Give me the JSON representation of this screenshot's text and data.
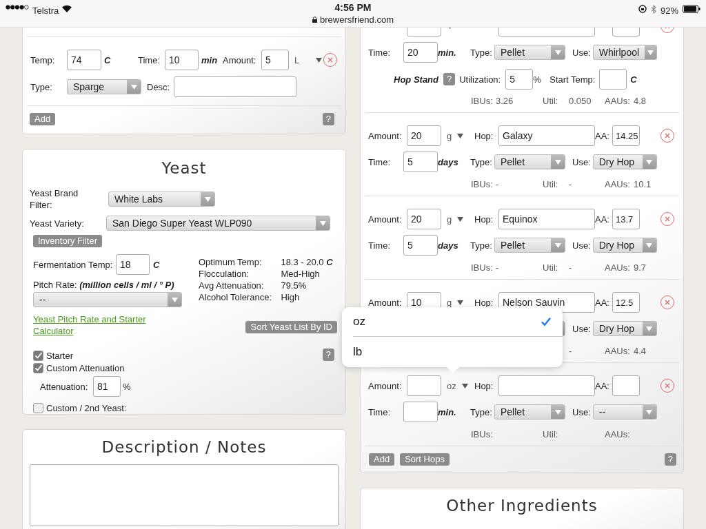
{
  "status_bar": {
    "carrier": "Telstra",
    "time": "4:56 PM",
    "url": "brewersfriend.com",
    "battery": "92%"
  },
  "mash_step": {
    "temp_label": "Temp:",
    "temp": "74",
    "temp_unit": "C",
    "time_label": "Time:",
    "time": "10",
    "time_unit": "min",
    "amount_label": "Amount:",
    "amount": "5",
    "amount_unit": "L",
    "type_label": "Type:",
    "type": "Sparge",
    "desc_label": "Desc:",
    "add": "Add",
    "help": "?"
  },
  "yeast": {
    "title": "Yeast",
    "brand_label": "Yeast Brand Filter:",
    "brand": "White Labs",
    "variety_label": "Yeast Variety:",
    "variety": "San Diego Super Yeast WLP090",
    "inventory": "Inventory Filter",
    "ferm_label": "Fermentation Temp:",
    "ferm": "18",
    "ferm_unit": "C",
    "pitch_label": "Pitch Rate: **(million cells / ml / ° P)**",
    "pitch": "--",
    "calculator_link": "Yeast Pitch Rate and Starter Calculator",
    "stats": [
      {
        "label": "Optimum Temp:",
        "value": "18.3 - 20.0 **C**"
      },
      {
        "label": "Flocculation:",
        "value": "Med-High"
      },
      {
        "label": "Avg Attenuation:",
        "value": "79.5%"
      },
      {
        "label": "Alcohol Tolerance:",
        "value": "High"
      }
    ],
    "sort": "Sort Yeast List By ID",
    "help": "?",
    "checks": [
      {
        "label": "Starter",
        "checked": true
      },
      {
        "label": "Custom Attenuation",
        "checked": true
      },
      {
        "label": "Custom / 2nd Yeast:",
        "checked": false
      }
    ],
    "attenuation_label": "Attenuation:",
    "attenuation": "81",
    "attenuation_unit": "%"
  },
  "notes": {
    "title": "Description / Notes"
  },
  "hops": {
    "entries": [
      {
        "time": "20",
        "time_unit": "min.",
        "type": "Pellet",
        "use": "Whirlpool",
        "ibus": "3.26",
        "util": "0.050",
        "aaus": "4.8",
        "labels": {
          "time": "Time:",
          "type": "Type:",
          "use": "Use:",
          "ibus": "IBUs:",
          "util": "Util:",
          "aaus": "AAUs:"
        },
        "hop_stand": {
          "label": "Hop Stand",
          "help": "?",
          "util_label": "Utilization:",
          "util": "5",
          "util_unit": "%",
          "start_label": "Start Temp:",
          "start_unit": "C"
        }
      },
      {
        "amount": "20",
        "unit": "g",
        "hop": "Galaxy",
        "aa": "14.25",
        "time": "5",
        "time_unit": "days",
        "type": "Pellet",
        "use": "Dry Hop",
        "ibus": "-",
        "util": "-",
        "aaus": "10.1",
        "labels": {
          "amount": "Amount:",
          "hop": "Hop:",
          "aa": "AA:",
          "time": "Time:",
          "type": "Type:",
          "use": "Use:",
          "ibus": "IBUs:",
          "util": "Util:",
          "aaus": "AAUs:"
        }
      },
      {
        "amount": "20",
        "unit": "g",
        "hop": "Equinox",
        "aa": "13.7",
        "time": "5",
        "time_unit": "days",
        "type": "Pellet",
        "use": "Dry Hop",
        "ibus": "-",
        "util": "-",
        "aaus": "9.7",
        "labels": {
          "amount": "Amount:",
          "hop": "Hop:",
          "aa": "AA:",
          "time": "Time:",
          "type": "Type:",
          "use": "Use:",
          "ibus": "IBUs:",
          "util": "Util:",
          "aaus": "AAUs:"
        }
      },
      {
        "amount": "10",
        "unit": "g",
        "hop": "Nelson Sauvin",
        "aa": "12.5",
        "use": "Dry Hop",
        "util": "-",
        "aaus": "4.4",
        "labels": {
          "amount": "Amount:",
          "hop": "Hop:",
          "aa": "AA:",
          "use": "Use:",
          "aaus": "AAUs:"
        }
      },
      {
        "unit": "oz",
        "time_unit": "min.",
        "type": "Pellet",
        "use": "--",
        "labels": {
          "amount": "Amount:",
          "hop": "Hop:",
          "aa": "AA:",
          "time": "Time:",
          "type": "Type:",
          "use": "Use:",
          "ibus": "IBUs:",
          "util": "Util:",
          "aaus": "AAUs:"
        }
      }
    ],
    "add": "Add",
    "sort": "Sort Hops",
    "help": "?"
  },
  "other": {
    "title": "Other Ingredients"
  },
  "unit_menu": {
    "options": [
      {
        "label": "oz",
        "selected": true
      },
      {
        "label": "lb",
        "selected": false
      }
    ]
  }
}
